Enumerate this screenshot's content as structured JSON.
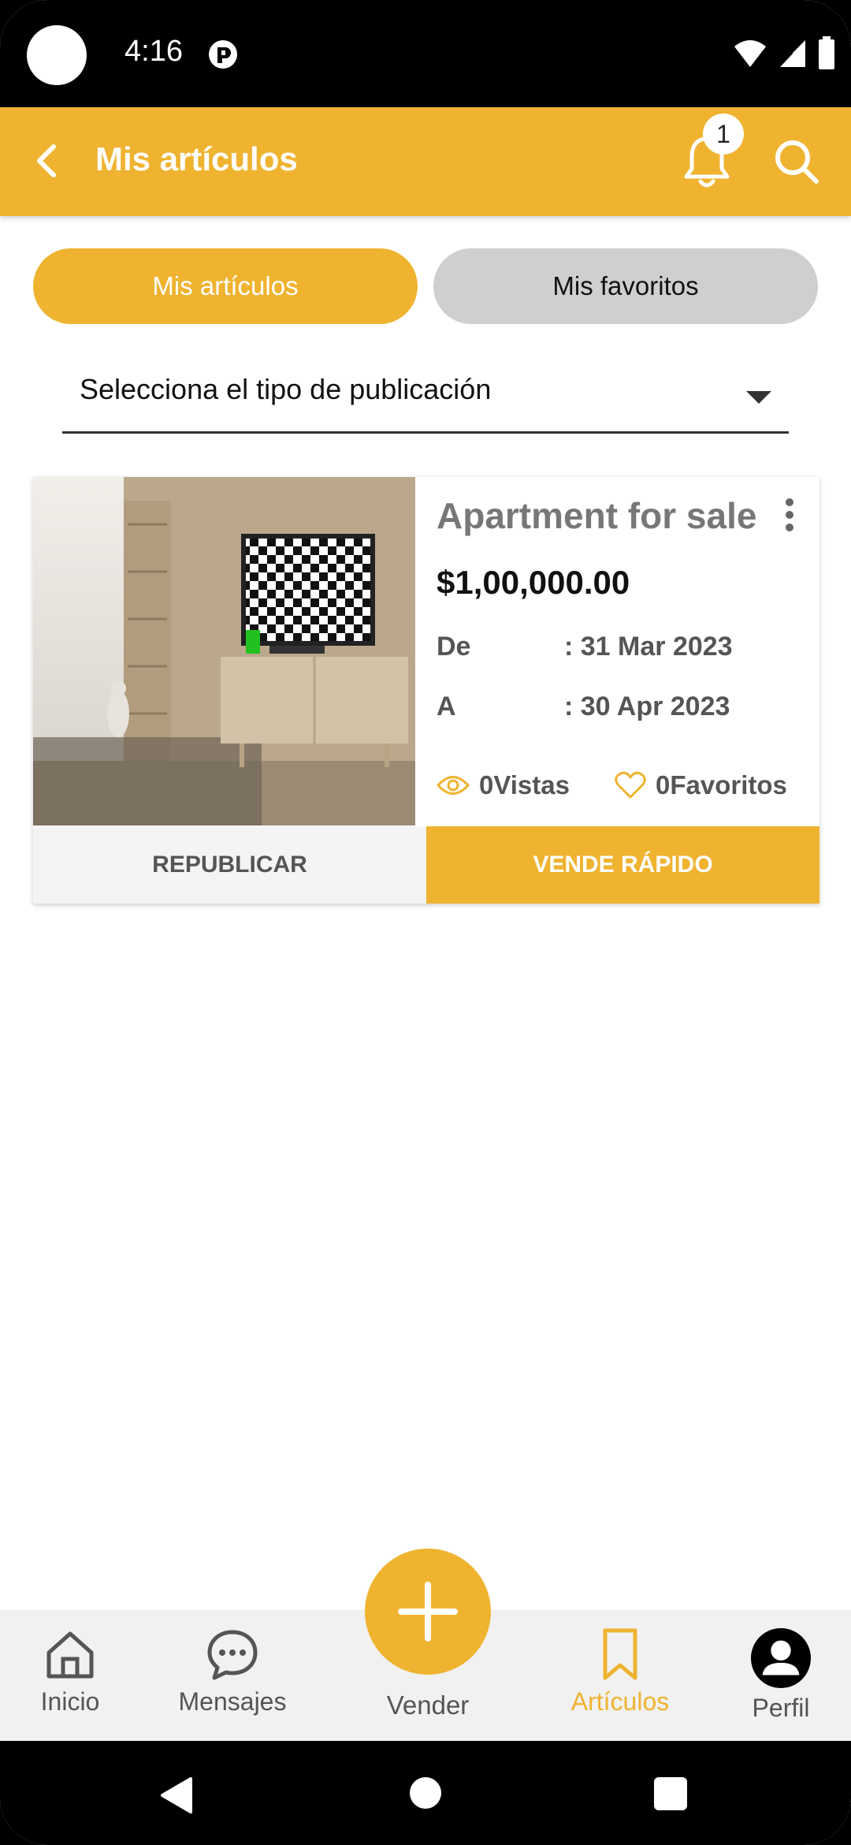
{
  "status_bar": {
    "time": "4:16"
  },
  "app_bar": {
    "title": "Mis artículos",
    "notification_count": "1"
  },
  "tabs": [
    {
      "label": "Mis artículos",
      "active": true
    },
    {
      "label": "Mis favoritos",
      "active": false
    }
  ],
  "dropdown": {
    "label": "Selecciona el tipo de publicación"
  },
  "listing": {
    "title": "Apartment for sale",
    "price": "$1,00,000.00",
    "from_label": "De",
    "from_value": ": 31 Mar 2023",
    "to_label": "A",
    "to_value": ": 30 Apr 2023",
    "views": "0Vistas",
    "favorites": "0Favoritos",
    "republish_label": "REPUBLICAR",
    "sell_fast_label": "VENDE RÁPIDO"
  },
  "bottom_nav": {
    "items": [
      {
        "label": "Inicio",
        "icon": "home-icon"
      },
      {
        "label": "Mensajes",
        "icon": "chat-icon"
      },
      {
        "label": "Vender",
        "icon": "plus-icon"
      },
      {
        "label": "Artículos",
        "icon": "bookmark-icon"
      },
      {
        "label": "Perfil",
        "icon": "user-icon"
      }
    ],
    "active_index": 3
  },
  "colors": {
    "accent": "#EFB330",
    "inactive_tab": "#CFCFCF",
    "text_muted": "#555555"
  }
}
